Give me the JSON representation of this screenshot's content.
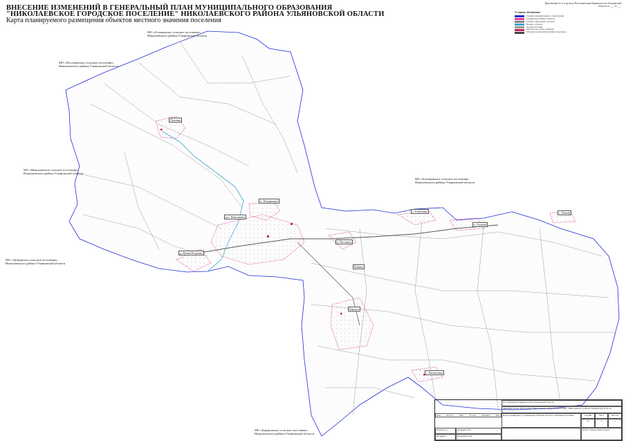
{
  "header": {
    "title_line1": "ВНЕСЕНИЕ ИЗМЕНЕНИЙ В ГЕНЕРАЛЬНЫЙ ПЛАН МУНИЦИПАЛЬНОГО ОБРАЗОВАНИЯ",
    "title_line2": "\"НИКОЛАЕВСКОЕ ГОРОДСКОЕ ПОСЕЛЕНИЕ\" НИКОЛАЕВСКОГО РАЙОНА УЛЬЯНОВСКОЙ ОБЛАСТИ",
    "title_line3": "Карта планируемого размещения объектов местного значения поселения",
    "top_note": "Приложение № 4 к проекту Постановления Правительства Ульяновской области от ___ № ___"
  },
  "neighbours": [
    {
      "line1": "МО «Головинское сельское поселение»",
      "line2": "Николаевского района Ульяновской области"
    },
    {
      "line1": "МО «Поселковское сельское поселение»",
      "line2": "Николаевского района Ульяновской области"
    },
    {
      "line1": "МО «Николаевское сельское поселение»",
      "line2": "Николаевского района Ульяновской области"
    },
    {
      "line1": "МО «Баевщинское сельское поселение»",
      "line2": "Николаевского района Ульяновской области"
    },
    {
      "line1": "МО «Дубровское сельское поселение»",
      "line2": "Николаевского района Ульяновской области"
    },
    {
      "line1": "МО «Барановское сельское поселение»",
      "line2": "Николаевского района Ульяновской области"
    }
  ],
  "places": {
    "p1": "Поповка",
    "p2": "п. Фонарковка",
    "p3": "р.п. Николаевка",
    "p4": "д. Новая Петровка",
    "p5": "с. Ключевка",
    "p6": "п. Рудный",
    "p7": "с. Новый",
    "p8": "п. Песчаное",
    "p9": "Ванино",
    "p10": "Барнаса",
    "p11": "с. Витязьевка"
  },
  "legend": {
    "heading": "Условные обозначения",
    "items": [
      {
        "text": "Граница муниципального образования",
        "color": "#1e2bd6"
      },
      {
        "text": "Граница населённых пунктов",
        "color": "#e0459a"
      },
      {
        "text": "Граница земельных участков",
        "color": "#888888"
      },
      {
        "text": "Водные объекты",
        "color": "#39a4c9"
      },
      {
        "text": "Лесные массивы",
        "color": "#9a9a9a"
      },
      {
        "text": "Объекты местного значения",
        "color": "#c0205a"
      },
      {
        "text": "Объекты транспортной инфраструктуры",
        "color": "#444444"
      }
    ]
  },
  "stamp": {
    "basis": "Постановление Правительства Ульяновской области",
    "org": "ОГКУ \"Кадастровая палата\"",
    "doc": "Карта планируемого размещения объектов местного значения поселения",
    "municipality": "Муниципальное образование \"Николаевское городское поселение\" Николаевского района Ульяновской области",
    "stage_label": "Стадия",
    "stage": "П",
    "sheet_label": "Лист",
    "sheet": "1",
    "sheets_label": "Листов",
    "sheets": "1",
    "cols": [
      "Изм.",
      "Кол.уч.",
      "Лист",
      "№ док.",
      "Подпись",
      "Дата"
    ],
    "developer_label": "Разработал",
    "developer": "Кузьмина Е.Н.",
    "checked_label": "Проверил",
    "checked": "Кузнецова Е.М."
  },
  "colors": {
    "boundary": "#1e2bd6",
    "settlement": "#e0459a",
    "river": "#39a4c9",
    "objects": "#c0205a"
  }
}
